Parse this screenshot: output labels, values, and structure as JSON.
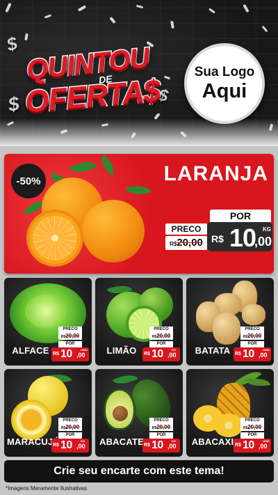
{
  "header": {
    "title_line1": "QUINTOU",
    "title_de": "DE",
    "title_line2": "OFERTA$",
    "logo_line1": "Sua Logo",
    "logo_line2": "Aqui"
  },
  "featured": {
    "badge": "-50%",
    "name": "LARANJA",
    "price_label": "PRECO",
    "old_currency": "R$",
    "old_price": "20,00",
    "por_label": "POR",
    "currency": "R$",
    "price_int": "10",
    "price_dec": ",00",
    "unit": "KG"
  },
  "products": [
    {
      "name": "ALFACE",
      "price_label": "PRECO",
      "old_currency": "R$",
      "old_price": "20,00",
      "por_label": "POR",
      "currency": "R$",
      "price_int": "10",
      "price_dec": ",00",
      "unit": "UNID"
    },
    {
      "name": "LIMÃO",
      "price_label": "PRECO",
      "old_currency": "R$",
      "old_price": "20,00",
      "por_label": "POR",
      "currency": "R$",
      "price_int": "10",
      "price_dec": ",00",
      "unit": "KG"
    },
    {
      "name": "BATATA",
      "price_label": "PRECO",
      "old_currency": "R$",
      "old_price": "20,00",
      "por_label": "POR",
      "currency": "R$",
      "price_int": "10",
      "price_dec": ",00",
      "unit": "UNID"
    },
    {
      "name": "MARACUJÁ",
      "price_label": "PRECO",
      "old_currency": "R$",
      "old_price": "20,00",
      "por_label": "POR",
      "currency": "R$",
      "price_int": "10",
      "price_dec": ",00",
      "unit": "KG"
    },
    {
      "name": "ABACATE",
      "price_label": "PRECO",
      "old_currency": "R$",
      "old_price": "20,00",
      "por_label": "POR",
      "currency": "R$",
      "price_int": "10",
      "price_dec": ",00",
      "unit": "KG"
    },
    {
      "name": "ABACAXI",
      "price_label": "PRECO",
      "old_currency": "R$",
      "old_price": "20,00",
      "por_label": "POR",
      "currency": "R$",
      "price_int": "10",
      "price_dec": ",00",
      "unit": "UNID"
    }
  ],
  "cta": "Crie seu encarte com este tema!",
  "disclaimer": "*Imagens Meramente Ilustrativas",
  "colors": {
    "accent_red": "#d8161d",
    "dark": "#161616",
    "white": "#ffffff"
  }
}
